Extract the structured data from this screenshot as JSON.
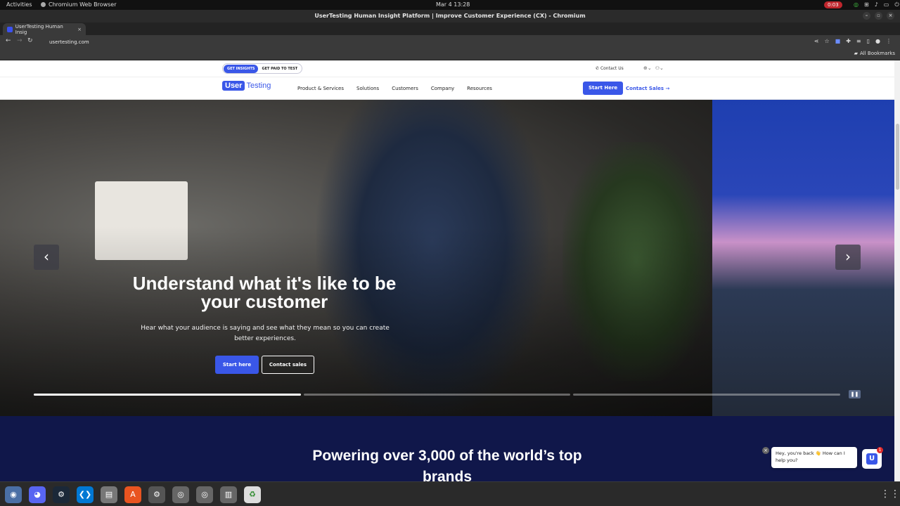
{
  "os": {
    "activities": "Activities",
    "app_name": "Chromium Web Browser",
    "clock": "Mar 4  13:28",
    "recording": "0:03"
  },
  "window": {
    "title": "UserTesting Human Insight Platform | Improve Customer Experience (CX) - Chromium"
  },
  "tabs": [
    {
      "label": "UserTesting Human Insig"
    }
  ],
  "address": {
    "url": "usertesting.com"
  },
  "bookmarks": {
    "all_label": "All Bookmarks"
  },
  "site": {
    "toggle": {
      "active": "GET INSIGHTS",
      "inactive": "GET PAID TO TEST"
    },
    "contact_us": "Contact Us",
    "logo": {
      "user": "User",
      "testing": "Testing"
    },
    "nav": [
      "Product & Services",
      "Solutions",
      "Customers",
      "Company",
      "Resources"
    ],
    "start_here": "Start Here",
    "contact_sales": "Contact Sales →"
  },
  "hero": {
    "headline": "Understand what it's like to be your customer",
    "subtext": "Hear what your audience is saying and see what they mean so you can create better experiences.",
    "primary_button": "Start here",
    "secondary_button": "Contact sales",
    "prev_icon": "‹",
    "next_icon": "›",
    "slide_progress": [
      1.0,
      0.0,
      0.0
    ]
  },
  "brands": {
    "heading": "Powering over 3,000 of the world’s top brands"
  },
  "chat": {
    "message": "Hey, you're back 👋 How can I help you?",
    "badge": "1"
  }
}
